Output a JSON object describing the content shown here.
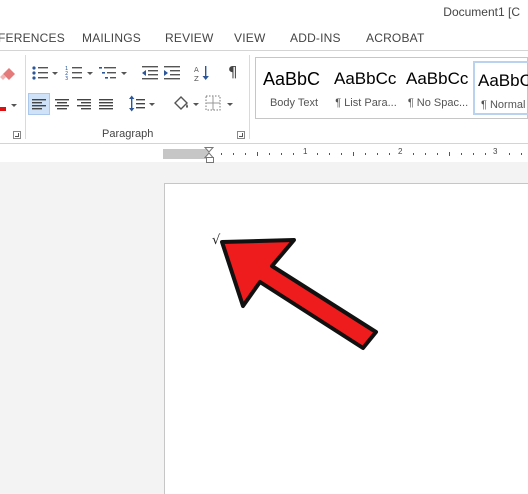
{
  "window": {
    "title": "Document1 [C"
  },
  "ribbon_tabs": [
    "FERENCES",
    "MAILINGS",
    "REVIEW",
    "VIEW",
    "ADD-INS",
    "ACROBAT"
  ],
  "paragraph_group": {
    "label": "Paragraph"
  },
  "styles": [
    {
      "preview": "AaBbC",
      "name": "Body Text"
    },
    {
      "preview": "AaBbCc",
      "name": "¶ List Para..."
    },
    {
      "preview": "AaBbCc",
      "name": "¶ No Spac..."
    },
    {
      "preview": "AaBbC",
      "name": "¶ Normal"
    }
  ],
  "ruler": {
    "numbers": [
      "1",
      "2",
      "3"
    ]
  },
  "document": {
    "body_text": "√"
  },
  "colors": {
    "annotation_arrow": "#ee1c1c",
    "ribbon_border": "#d4d4d4",
    "selected_button_bg": "#cfe2f7"
  },
  "icons": [
    "eraser-icon",
    "bullets-icon",
    "numbering-icon",
    "multilevel-list-icon",
    "decrease-indent-icon",
    "increase-indent-icon",
    "sort-icon",
    "show-formatting-icon",
    "align-left-icon",
    "center-icon",
    "align-right-icon",
    "justify-icon",
    "line-spacing-icon",
    "shading-icon",
    "borders-icon"
  ]
}
